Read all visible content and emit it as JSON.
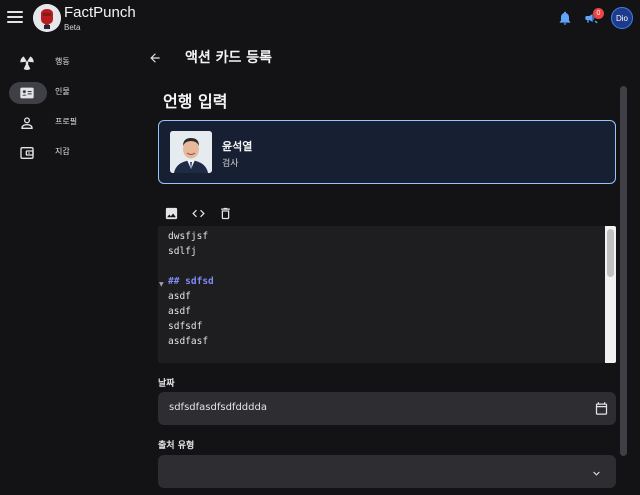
{
  "app": {
    "name": "FactPunch",
    "subtitle": "Beta",
    "notification_count": "0",
    "avatar_initials": "Dio"
  },
  "sidebar": {
    "items": [
      {
        "label": "행동",
        "icon": "radiation-icon"
      },
      {
        "label": "인물",
        "icon": "id-card-icon",
        "active": true
      },
      {
        "label": "프로필",
        "icon": "person-icon"
      },
      {
        "label": "지갑",
        "icon": "wallet-icon"
      }
    ]
  },
  "page": {
    "title": "액션 카드 등록",
    "section_title": "언행 입력"
  },
  "person": {
    "name": "윤석열",
    "role": "검사"
  },
  "editor": {
    "toolbar": [
      "image-icon",
      "code-icon",
      "trash-icon"
    ],
    "lines": [
      "dwsfjsf",
      "sdlfj",
      "",
      "## sdfsd",
      "asdf",
      "asdf",
      "sdfsdf",
      "asdfasf"
    ]
  },
  "form": {
    "date_label": "날짜",
    "date_value": "sdfsdfasdfsdfdddda",
    "source_label": "출처 유형",
    "source_value": ""
  },
  "colors": {
    "background": "#131316",
    "card_border": "#93c5fd",
    "card_bg": "#162032",
    "input_bg": "#2e2e32",
    "heading_code": "#7c8cf5",
    "badge": "#ef4444"
  }
}
